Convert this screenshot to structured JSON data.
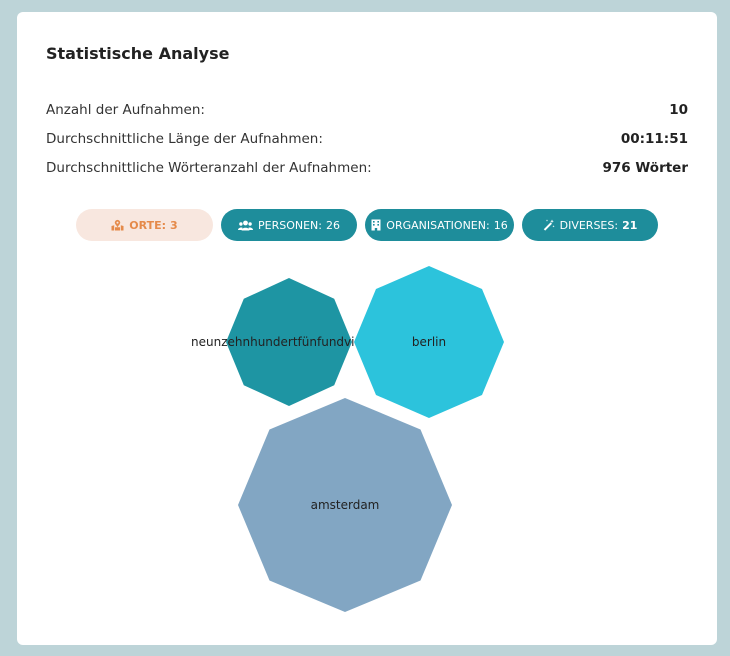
{
  "title": "Statistische Analyse",
  "stats": [
    {
      "label": "Anzahl der Aufnahmen:",
      "value": "10"
    },
    {
      "label": "Durchschnittliche Länge der Aufnahmen:",
      "value": "00:11:51"
    },
    {
      "label": "Durchschnittliche Wörteranzahl der Aufnahmen:",
      "value": "976 Wörter"
    }
  ],
  "tabs": [
    {
      "label": "ORTE:",
      "count": "3",
      "icon": "map-icon",
      "active": true
    },
    {
      "label": "PERSONEN:",
      "count": "26",
      "icon": "people-icon",
      "active": false
    },
    {
      "label": "ORGANISATIONEN:",
      "count": "16",
      "icon": "building-icon",
      "active": false
    },
    {
      "label": "DIVERSES:",
      "count": "21",
      "icon": "magic-wand-icon",
      "active": false
    }
  ],
  "bubbles": [
    {
      "label": "neunzehnhundertfünfundvierzig",
      "color": "#1e95a3"
    },
    {
      "label": "berlin",
      "color": "#2cc3dc"
    },
    {
      "label": "amsterdam",
      "color": "#82a6c3"
    }
  ],
  "colors": {
    "background": "#bdd4d8",
    "tab_active_bg": "#f8e7df",
    "tab_active_text": "#e58a4a",
    "tab_bg": "#1e8d9b"
  }
}
